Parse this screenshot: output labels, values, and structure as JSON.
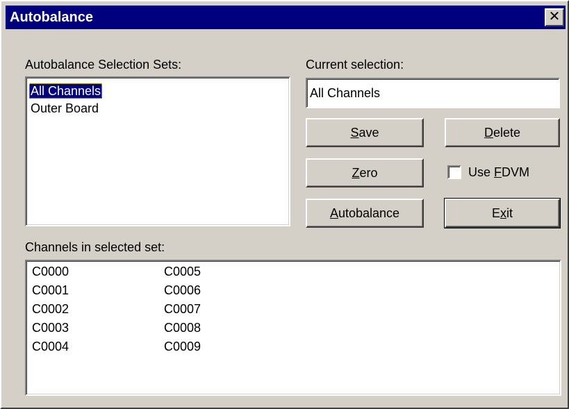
{
  "window": {
    "title": "Autobalance",
    "close_glyph": "✕"
  },
  "selection_sets": {
    "label": "Autobalance Selection Sets:",
    "items": [
      "All Channels",
      "Outer Board"
    ],
    "selected_index": 0
  },
  "current_selection": {
    "label": "Current selection:",
    "value": "All Channels"
  },
  "buttons": {
    "save": {
      "pre": "",
      "mnemonic": "S",
      "post": "ave"
    },
    "delete": {
      "pre": "",
      "mnemonic": "D",
      "post": "elete"
    },
    "zero": {
      "pre": "",
      "mnemonic": "Z",
      "post": "ero"
    },
    "autobalance": {
      "pre": "",
      "mnemonic": "A",
      "post": "utobalance"
    },
    "exit": {
      "pre": "E",
      "mnemonic": "x",
      "post": "it"
    }
  },
  "use_fdvm": {
    "pre": "Use ",
    "mnemonic": "F",
    "post": "DVM",
    "checked": false
  },
  "channels": {
    "label": "Channels in selected set:",
    "column1": [
      "C0000",
      "C0001",
      "C0002",
      "C0003",
      "C0004"
    ],
    "column2": [
      "C0005",
      "C0006",
      "C0007",
      "C0008",
      "C0009"
    ]
  }
}
